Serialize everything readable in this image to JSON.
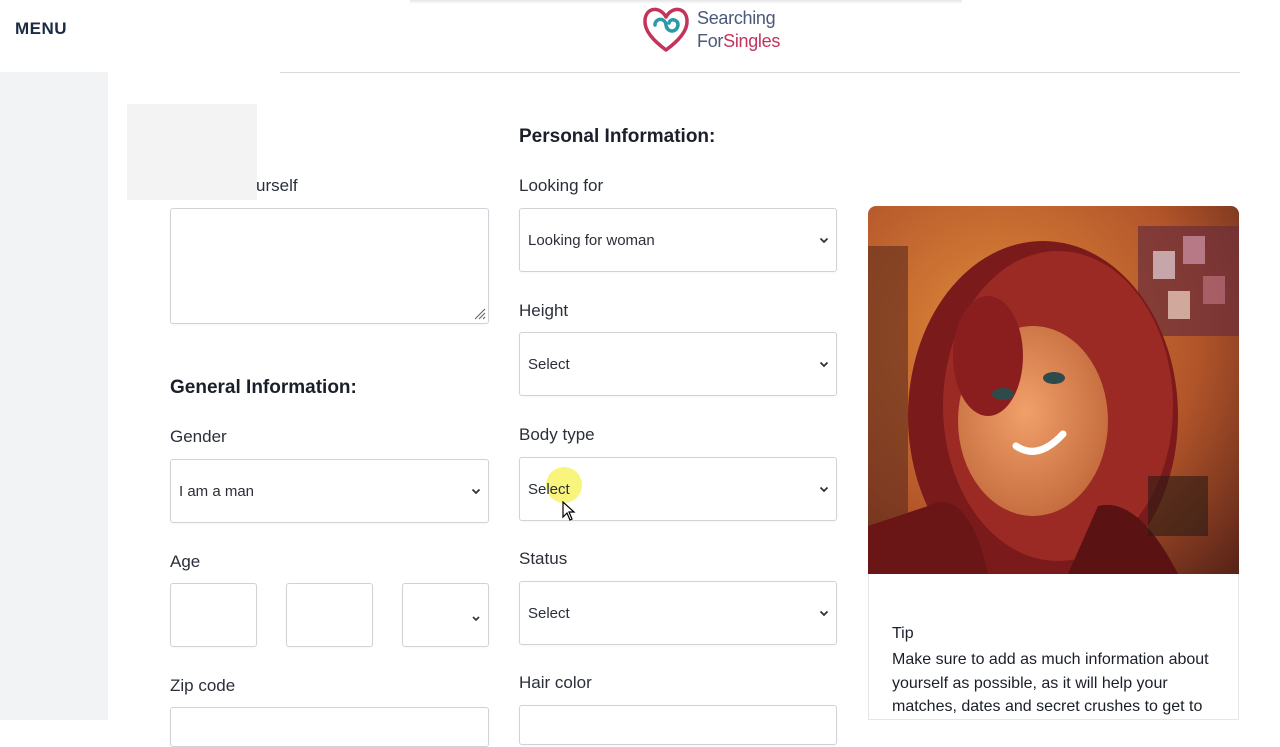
{
  "header": {
    "menu_label": "MENU",
    "logo": {
      "line1": "Searching",
      "line2_prefix": "For",
      "line2_suffix": "Singles"
    }
  },
  "about": {
    "label_partial": "urself"
  },
  "personal": {
    "title": "Personal Information:",
    "looking_for": {
      "label": "Looking for",
      "value": "Looking for woman"
    },
    "height": {
      "label": "Height",
      "value": "Select"
    },
    "body_type": {
      "label": "Body type",
      "value": "Select"
    },
    "status": {
      "label": "Status",
      "value": "Select"
    },
    "hair_color": {
      "label": "Hair color"
    }
  },
  "general": {
    "title": "General Information:",
    "gender": {
      "label": "Gender",
      "value": "I am a man"
    },
    "age": {
      "label": "Age"
    },
    "zip": {
      "label": "Zip code"
    }
  },
  "tip": {
    "title": "Tip",
    "body": "Make sure to add as much information about yourself as possible, as it will help your matches, dates and secret crushes to get to"
  },
  "colors": {
    "brand_text": "#4a5a78",
    "brand_accent": "#c3335c",
    "logo_teal": "#2a9aa8"
  },
  "icons": [
    "logo-mark-icon",
    "chevron-down-icon",
    "resize-grip-icon",
    "mouse-cursor-icon"
  ]
}
